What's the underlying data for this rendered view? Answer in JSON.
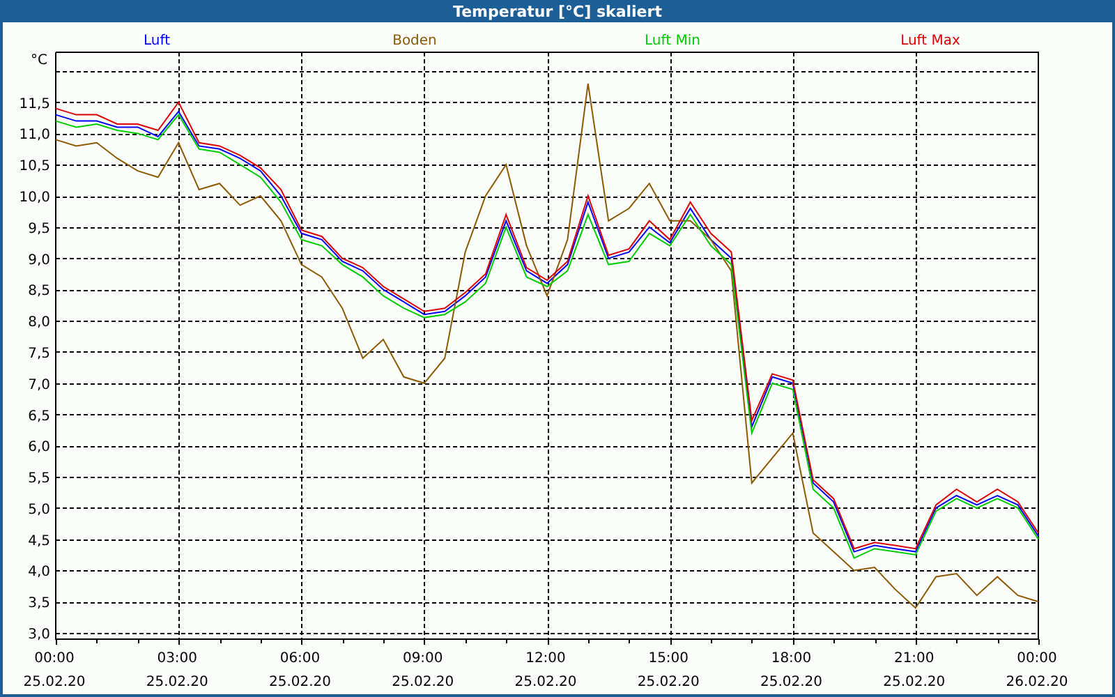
{
  "window": {
    "title": "Temperatur [°C] skaliert"
  },
  "chart": {
    "unit_label": "°C",
    "date_labels": [
      "25.02.20",
      "25.02.20",
      "25.02.20",
      "25.02.20",
      "25.02.20",
      "25.02.20",
      "25.02.20",
      "25.02.20",
      "26.02.20"
    ],
    "chart_data": {
      "type": "line",
      "grid": true,
      "x": [
        0,
        0.5,
        1,
        1.5,
        2,
        2.5,
        3,
        3.5,
        4,
        4.5,
        5,
        5.5,
        6,
        6.5,
        7,
        7.5,
        8,
        8.5,
        9,
        9.5,
        10,
        10.5,
        11,
        11.5,
        12,
        12.5,
        13,
        13.5,
        14,
        14.5,
        15,
        15.5,
        16,
        16.5,
        17,
        17.5,
        18,
        18.5,
        19,
        19.5,
        20,
        20.5,
        21,
        21.5,
        22,
        22.5,
        23,
        23.5,
        24
      ],
      "series": [
        {
          "name": "Luft",
          "color": "#0000ff",
          "values": [
            11.3,
            11.2,
            11.2,
            11.1,
            11.1,
            10.95,
            11.35,
            10.8,
            10.75,
            10.6,
            10.4,
            10.0,
            9.4,
            9.3,
            8.95,
            8.8,
            8.5,
            8.3,
            8.1,
            8.15,
            8.4,
            8.7,
            9.6,
            8.8,
            8.6,
            8.9,
            9.9,
            9.0,
            9.1,
            9.5,
            9.25,
            9.8,
            9.3,
            9.0,
            6.3,
            7.1,
            7.0,
            5.4,
            5.1,
            4.3,
            4.4,
            4.35,
            4.3,
            5.0,
            5.2,
            5.05,
            5.2,
            5.05,
            4.55
          ]
        },
        {
          "name": "Boden",
          "color": "#8b5a00",
          "values": [
            10.9,
            10.8,
            10.85,
            10.6,
            10.4,
            10.3,
            10.85,
            10.1,
            10.2,
            9.85,
            10.0,
            9.6,
            8.9,
            8.7,
            8.2,
            7.4,
            7.7,
            7.1,
            7.0,
            7.4,
            9.1,
            10.0,
            10.5,
            9.2,
            8.4,
            9.3,
            11.8,
            9.6,
            9.8,
            10.2,
            9.6,
            9.6,
            9.3,
            8.8,
            5.4,
            5.8,
            6.2,
            4.6,
            4.3,
            4.0,
            4.05,
            3.7,
            3.4,
            3.9,
            3.95,
            3.6,
            3.9,
            3.6,
            3.5
          ]
        },
        {
          "name": "Luft Min",
          "color": "#00cc00",
          "values": [
            11.2,
            11.1,
            11.15,
            11.05,
            11.0,
            10.9,
            11.3,
            10.75,
            10.7,
            10.5,
            10.3,
            9.9,
            9.3,
            9.2,
            8.9,
            8.7,
            8.4,
            8.2,
            8.05,
            8.1,
            8.3,
            8.6,
            9.5,
            8.7,
            8.55,
            8.8,
            9.7,
            8.9,
            8.95,
            9.4,
            9.2,
            9.7,
            9.2,
            8.9,
            6.2,
            7.0,
            6.9,
            5.3,
            5.0,
            4.2,
            4.35,
            4.3,
            4.25,
            4.95,
            5.15,
            5.0,
            5.15,
            5.0,
            4.5
          ]
        },
        {
          "name": "Luft Max",
          "color": "#dd0000",
          "values": [
            11.4,
            11.3,
            11.3,
            11.15,
            11.15,
            11.05,
            11.5,
            10.85,
            10.8,
            10.65,
            10.45,
            10.1,
            9.45,
            9.35,
            9.0,
            8.85,
            8.55,
            8.35,
            8.15,
            8.2,
            8.45,
            8.75,
            9.7,
            8.85,
            8.65,
            8.95,
            10.0,
            9.05,
            9.15,
            9.6,
            9.3,
            9.9,
            9.4,
            9.1,
            6.4,
            7.15,
            7.05,
            5.45,
            5.15,
            4.35,
            4.45,
            4.4,
            4.35,
            5.05,
            5.3,
            5.1,
            5.3,
            5.1,
            4.6
          ]
        }
      ],
      "xlim": [
        0,
        24
      ],
      "ylim": [
        2.9,
        12.3
      ],
      "xticks": [
        {
          "value": 0,
          "label": "00:00"
        },
        {
          "value": 3,
          "label": "03:00"
        },
        {
          "value": 6,
          "label": "06:00"
        },
        {
          "value": 9,
          "label": "09:00"
        },
        {
          "value": 12,
          "label": "12:00"
        },
        {
          "value": 15,
          "label": "15:00"
        },
        {
          "value": 18,
          "label": "18:00"
        },
        {
          "value": 21,
          "label": "21:00"
        },
        {
          "value": 24,
          "label": "00:00"
        }
      ],
      "yticks": [
        {
          "value": 3,
          "label": "3,0"
        },
        {
          "value": 3.5,
          "label": "3,5"
        },
        {
          "value": 4,
          "label": "4,0"
        },
        {
          "value": 4.5,
          "label": "4,5"
        },
        {
          "value": 5,
          "label": "5,0"
        },
        {
          "value": 5.5,
          "label": "5,5"
        },
        {
          "value": 6,
          "label": "6,0"
        },
        {
          "value": 6.5,
          "label": "6,5"
        },
        {
          "value": 7,
          "label": "7,0"
        },
        {
          "value": 7.5,
          "label": "7,5"
        },
        {
          "value": 8,
          "label": "8,0"
        },
        {
          "value": 8.5,
          "label": "8,5"
        },
        {
          "value": 9,
          "label": "9,0"
        },
        {
          "value": 9.5,
          "label": "9,5"
        },
        {
          "value": 10,
          "label": "10,0"
        },
        {
          "value": 10.5,
          "label": "10,5"
        },
        {
          "value": 11,
          "label": "11,0"
        },
        {
          "value": 11.5,
          "label": "11,5"
        }
      ]
    }
  }
}
